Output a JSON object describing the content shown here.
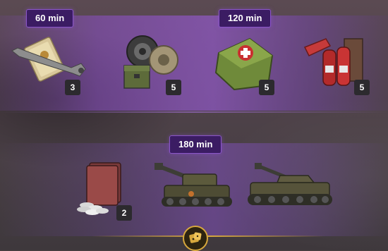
{
  "rewards": {
    "top": {
      "badge_left": "60 min",
      "badge_right": "120 min",
      "items": [
        {
          "name": "repair kit",
          "count": "3"
        },
        {
          "name": "track spares",
          "count": "5"
        },
        {
          "name": "first aid kit",
          "count": "5"
        },
        {
          "name": "fire extinguishers",
          "count": "5"
        }
      ]
    },
    "bottom": {
      "badge": "180 min",
      "items": [
        {
          "name": "credits and book",
          "count": "2"
        },
        {
          "name": "tank destroyer",
          "count": ""
        },
        {
          "name": "medium tank",
          "count": ""
        }
      ]
    }
  },
  "icons": {
    "bottom": "gold-dice-icon"
  },
  "colors": {
    "accent": "#8a55c8",
    "badge_bg": "#3b1c63",
    "gold": "#d7a83d"
  }
}
